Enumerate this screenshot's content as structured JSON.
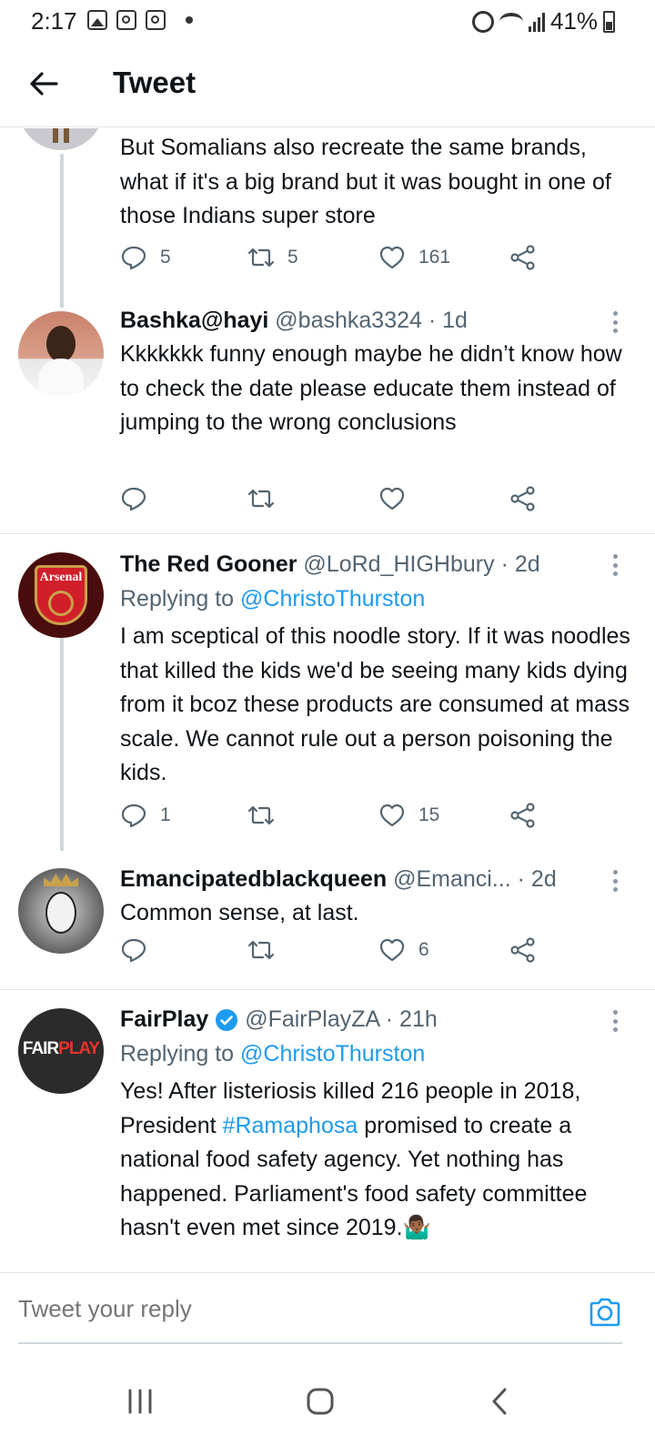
{
  "status_bar": {
    "time": "2:17",
    "battery": "41%"
  },
  "header": {
    "title": "Tweet"
  },
  "tweets": [
    {
      "text": "But Somalians also recreate the same brands, what if it's a big brand but it was bought in one of those Indians super store",
      "replies": "5",
      "retweets": "5",
      "likes": "161"
    },
    {
      "name": "Bashka@hayi",
      "handle": "@bashka3324",
      "time": "· 1d",
      "text": "Kkkkkkk funny enough maybe he didn’t know how to check the date please educate them instead of jumping to the wrong conclusions",
      "replies": "",
      "retweets": "",
      "likes": ""
    },
    {
      "name": "The Red Gooner",
      "handle": "@LoRd_HIGHbury",
      "time": "· 2d",
      "replying_prefix": "Replying to",
      "replying_to": "@ChristoThurston",
      "text": "I am sceptical of this noodle story. If it was noodles that killed the kids we'd be seeing many kids dying from it bcoz these products are consumed at mass scale. We cannot rule out a person poisoning the kids.",
      "replies": "1",
      "retweets": "",
      "likes": "15",
      "avatar_text": "Arsenal"
    },
    {
      "name": "Emancipatedblackqueen",
      "handle": "@Emanci...",
      "time": "· 2d",
      "text": "Common sense, at last.",
      "replies": "",
      "retweets": "",
      "likes": "6"
    },
    {
      "name": "FairPlay",
      "handle": "@FairPlayZA",
      "time": "· 21h",
      "replying_prefix": "Replying to",
      "replying_to": "@ChristoThurston",
      "text_before": "Yes! After listeriosis killed 216 people in 2018, President ",
      "hashtag": "#Ramaphosa",
      "text_after": " promised to create a national food safety agency. Yet nothing has happened. Parliament's food safety committee hasn't even met since 2019.🤷🏾‍♂️",
      "avatar_text_fair": "FAIR",
      "avatar_text_play": "PLAY"
    }
  ],
  "reply_bar": {
    "placeholder": "Tweet your reply"
  },
  "colors": {
    "link": "#1d9bf0",
    "secondary_text": "#536471",
    "divider": "#e1e5e8"
  },
  "icons": [
    "back-arrow-icon",
    "reply-icon",
    "retweet-icon",
    "like-icon",
    "share-icon",
    "more-icon",
    "verified-icon",
    "camera-icon",
    "recents-icon",
    "home-icon",
    "back-icon"
  ]
}
